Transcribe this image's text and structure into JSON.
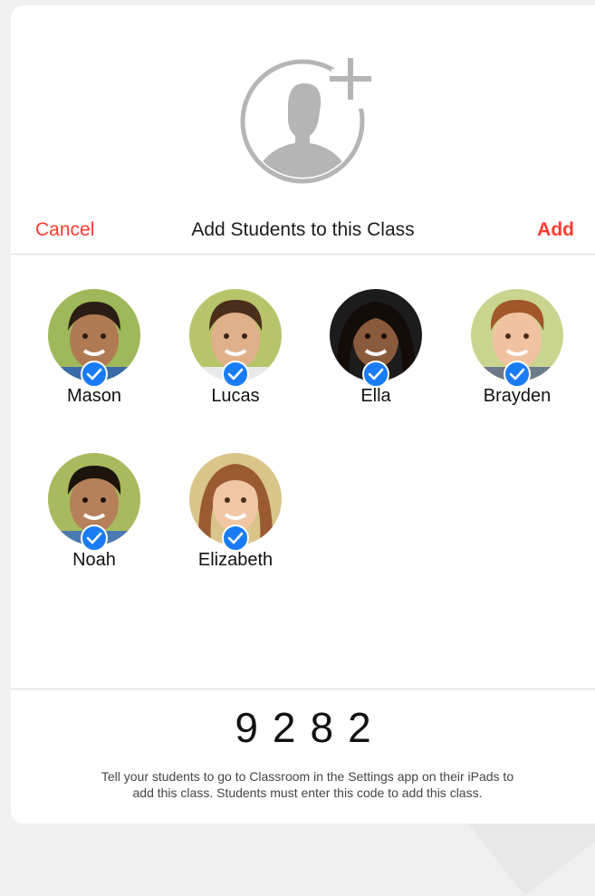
{
  "header": {
    "cancel_label": "Cancel",
    "title": "Add Students to this Class",
    "add_label": "Add"
  },
  "icons": {
    "hero": "add-person-icon",
    "check": "checkmark-circle-icon"
  },
  "colors": {
    "accent": "#ff3b30",
    "check": "#1a7cf5",
    "icon_gray": "#b5b5b5"
  },
  "students": [
    {
      "name": "Mason",
      "selected": true
    },
    {
      "name": "Lucas",
      "selected": true
    },
    {
      "name": "Ella",
      "selected": true
    },
    {
      "name": "Brayden",
      "selected": true
    },
    {
      "name": "Noah",
      "selected": true
    },
    {
      "name": "Elizabeth",
      "selected": true
    }
  ],
  "footer": {
    "code": "9282",
    "instructions_line1": "Tell your students to go to Classroom in the Settings app on their iPads to",
    "instructions_line2": "add this class. Students must enter this code to add this class."
  }
}
